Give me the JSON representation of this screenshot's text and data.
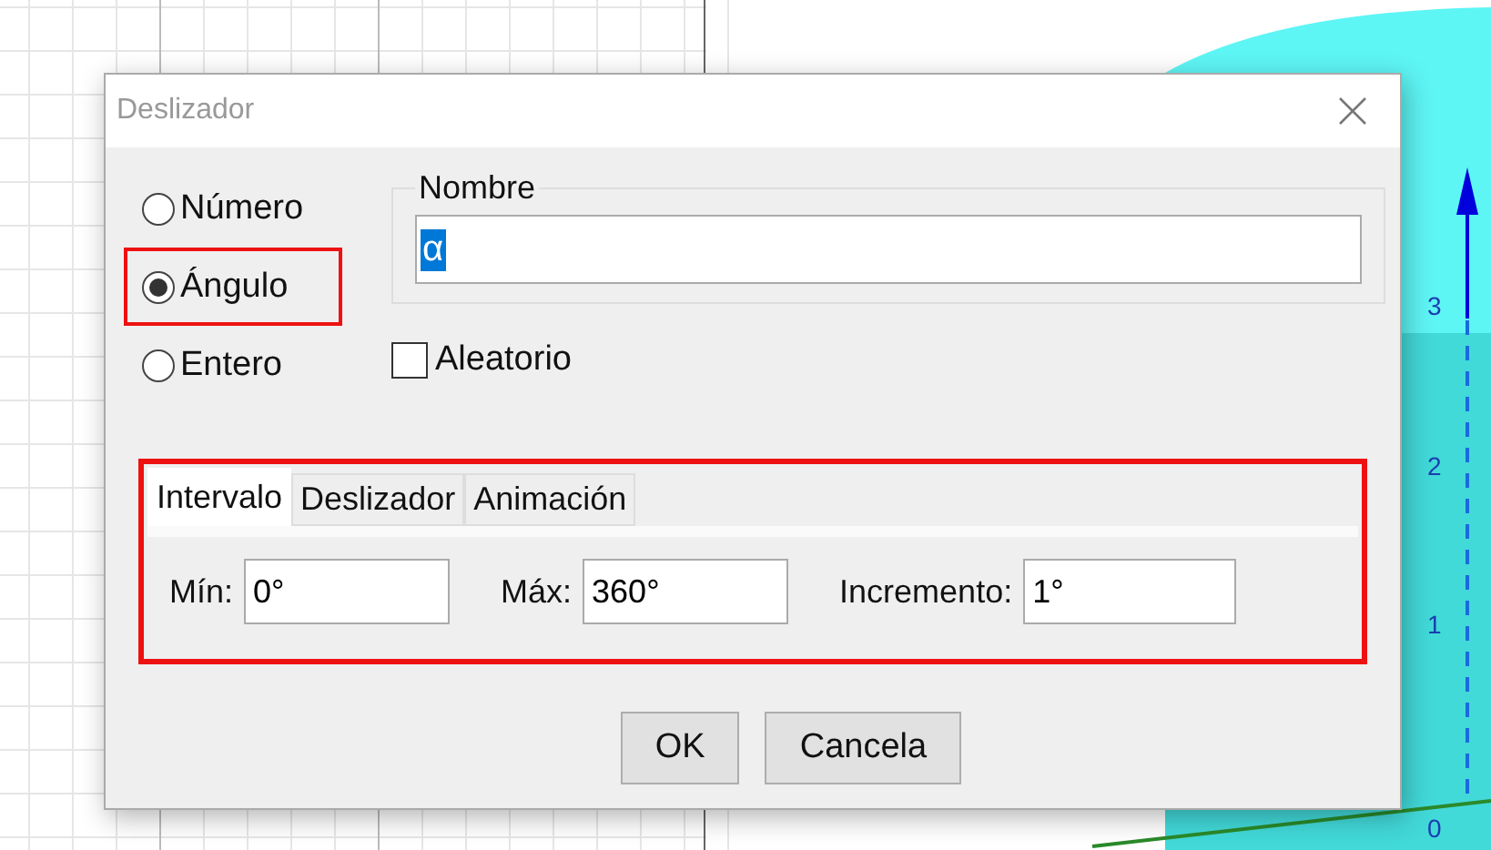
{
  "background": {
    "axis_labels": [
      "3",
      "2",
      "1",
      "0"
    ]
  },
  "dialog": {
    "title": "Deslizador",
    "types": [
      {
        "label": "Número",
        "selected": false,
        "highlighted": false
      },
      {
        "label": "Ángulo",
        "selected": true,
        "highlighted": true
      },
      {
        "label": "Entero",
        "selected": false,
        "highlighted": false
      }
    ],
    "name_group": {
      "title": "Nombre",
      "value": "α",
      "text_selected": true
    },
    "random": {
      "label": "Aleatorio",
      "checked": false
    },
    "tabs_panel": {
      "highlighted": true,
      "tabs": [
        {
          "label": "Intervalo",
          "selected": true
        },
        {
          "label": "Deslizador",
          "selected": false
        },
        {
          "label": "Animación",
          "selected": false
        }
      ],
      "fields": [
        {
          "label": "Mín:",
          "value": "0°"
        },
        {
          "label": "Máx:",
          "value": "360°"
        },
        {
          "label": "Incremento:",
          "value": "1°"
        }
      ]
    },
    "buttons": [
      "OK",
      "Cancela"
    ]
  }
}
